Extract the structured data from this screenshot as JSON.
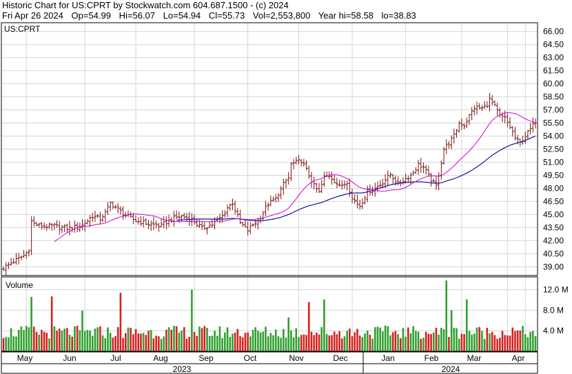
{
  "header": {
    "title": "Historic Chart for US:CPRT by Stockwatch.com 604.687.1500 - (c) 2024",
    "date": "Fri Apr 26 2024",
    "open": "Op=54.99",
    "high": "Hi=56.07",
    "low": "Lo=54.94",
    "close": "Cl=55.73",
    "volume": "Vol=2,553,800",
    "year_high": "Year hi=58.58",
    "year_low": "lo=38.83"
  },
  "chart_data": [
    {
      "type": "ohlc",
      "symbol_label": "US:CPRT",
      "ylim": [
        38.0,
        67.0
      ],
      "ytick_labels": [
        "66.00",
        "64.50",
        "63.00",
        "61.50",
        "60.00",
        "58.50",
        "57.00",
        "55.50",
        "54.00",
        "52.50",
        "51.00",
        "49.50",
        "48.00",
        "46.50",
        "45.00",
        "43.50",
        "42.00",
        "40.50",
        "39.00"
      ],
      "colors": {
        "bars": "#7a1010",
        "ma_short": "#d000d0",
        "ma_long": "#1010a0",
        "grid": "#d4d4d4"
      },
      "close_anchors": [
        [
          0,
          38.9
        ],
        [
          4,
          39.6
        ],
        [
          8,
          40.3
        ],
        [
          10,
          41.0
        ],
        [
          11,
          44.2
        ],
        [
          13,
          43.8
        ],
        [
          16,
          43.6
        ],
        [
          20,
          43.7
        ],
        [
          25,
          43.4
        ],
        [
          30,
          43.6
        ],
        [
          35,
          44.8
        ],
        [
          38,
          44.5
        ],
        [
          40,
          45.2
        ],
        [
          42,
          46.3
        ],
        [
          45,
          45.6
        ],
        [
          48,
          44.9
        ],
        [
          52,
          44.3
        ],
        [
          57,
          43.9
        ],
        [
          62,
          43.7
        ],
        [
          66,
          44.5
        ],
        [
          70,
          44.8
        ],
        [
          74,
          44.4
        ],
        [
          78,
          43.4
        ],
        [
          82,
          43.9
        ],
        [
          86,
          44.8
        ],
        [
          88,
          45.8
        ],
        [
          90,
          46.3
        ],
        [
          93,
          44.0
        ],
        [
          96,
          43.2
        ],
        [
          98,
          43.8
        ],
        [
          101,
          44.8
        ],
        [
          104,
          46.2
        ],
        [
          107,
          46.8
        ],
        [
          110,
          48.5
        ],
        [
          112,
          49.2
        ],
        [
          113,
          50.8
        ],
        [
          115,
          51.0
        ],
        [
          117,
          51.2
        ],
        [
          120,
          49.5
        ],
        [
          122,
          48.3
        ],
        [
          124,
          47.5
        ],
        [
          126,
          49.3
        ],
        [
          128,
          49.5
        ],
        [
          130,
          48.9
        ],
        [
          132,
          48.2
        ],
        [
          135,
          48.8
        ],
        [
          137,
          46.8
        ],
        [
          140,
          46.0
        ],
        [
          143,
          47.6
        ],
        [
          146,
          48.0
        ],
        [
          149,
          48.7
        ],
        [
          152,
          49.6
        ],
        [
          155,
          48.5
        ],
        [
          157,
          48.9
        ],
        [
          160,
          49.5
        ],
        [
          163,
          50.7
        ],
        [
          165,
          50.4
        ],
        [
          168,
          49.0
        ],
        [
          170,
          48.2
        ],
        [
          171,
          49.6
        ],
        [
          173,
          52.5
        ],
        [
          175,
          53.2
        ],
        [
          177,
          54.0
        ],
        [
          179,
          55.5
        ],
        [
          181,
          55.2
        ],
        [
          183,
          56.3
        ],
        [
          185,
          57.3
        ],
        [
          188,
          57.2
        ],
        [
          190,
          57.6
        ],
        [
          191,
          58.2
        ],
        [
          193,
          57.4
        ],
        [
          195,
          56.3
        ],
        [
          197,
          56.0
        ],
        [
          199,
          55.0
        ],
        [
          201,
          53.8
        ],
        [
          203,
          53.2
        ],
        [
          205,
          54.0
        ],
        [
          207,
          54.8
        ],
        [
          209,
          55.7
        ]
      ],
      "volume_axis": {
        "ylim": [
          0,
          14.5
        ],
        "tick_labels": [
          "12.0 M",
          "8.0 M",
          "4.0 M"
        ]
      },
      "volume_anchors": [
        [
          0,
          3.2
        ],
        [
          10,
          3.4
        ],
        [
          11,
          10.6
        ],
        [
          18,
          3.0
        ],
        [
          19,
          10.7
        ],
        [
          30,
          3.8
        ],
        [
          31,
          7.9
        ],
        [
          45,
          3.4
        ],
        [
          46,
          11.4
        ],
        [
          60,
          3.6
        ],
        [
          70,
          3.4
        ],
        [
          74,
          12.0
        ],
        [
          85,
          3.2
        ],
        [
          100,
          3.8
        ],
        [
          112,
          6.6
        ],
        [
          120,
          9.6
        ],
        [
          126,
          10.1
        ],
        [
          135,
          3.5
        ],
        [
          137,
          2.3
        ],
        [
          140,
          3.2
        ],
        [
          150,
          3.6
        ],
        [
          160,
          3.4
        ],
        [
          172,
          4.2
        ],
        [
          174,
          13.8
        ],
        [
          176,
          8.0
        ],
        [
          182,
          10.1
        ],
        [
          190,
          3.8
        ],
        [
          200,
          3.4
        ],
        [
          208,
          4.5
        ],
        [
          209,
          3.4
        ]
      ],
      "legend": {
        "volume": "Volume"
      },
      "xaxis": {
        "months": [
          "May",
          "Jun",
          "Jul",
          "Aug",
          "Sep",
          "Oct",
          "Nov",
          "Dec",
          "Jan",
          "Feb",
          "Mar",
          "Apr"
        ],
        "years": [
          "2023",
          "2024"
        ]
      }
    }
  ]
}
